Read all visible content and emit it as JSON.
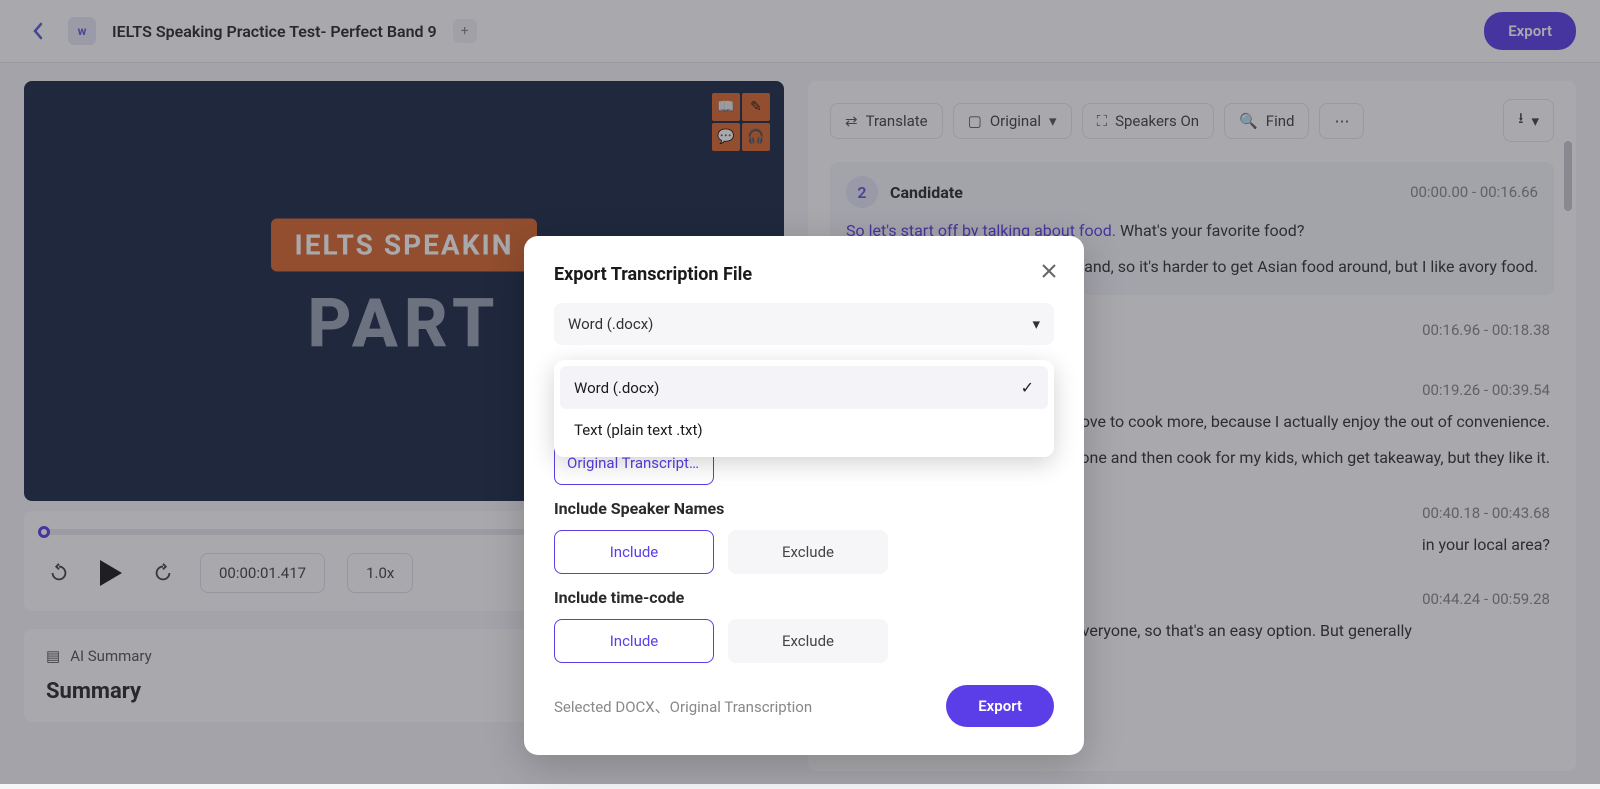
{
  "header": {
    "title": "IELTS Speaking Practice Test- Perfect Band 9",
    "export_label": "Export"
  },
  "video": {
    "badge": "IELTS SPEAKIN",
    "part": "PART",
    "time": "00:00:01.417",
    "speed": "1.0x"
  },
  "ai_summary": {
    "header": "AI Summary",
    "title": "Summary"
  },
  "toolbar": {
    "translate": "Translate",
    "original": "Original",
    "speakers": "Speakers On",
    "find": "Find"
  },
  "transcript": [
    {
      "badge": "2",
      "speaker": "Candidate",
      "time": "00:00.00 - 00:16.66",
      "highlight": "So let's start off by talking about food.",
      "rest": " What's your favorite food?",
      "body": "gland, so it's harder to get Asian food around, but I like avory food."
    },
    {
      "time": "00:16.96 - 00:18.38"
    },
    {
      "time": "00:19.26 - 00:39.54",
      "body": "ould love to cook more, because I actually enjoy the out of convenience.",
      "body2": "et my work done and then cook for my kids, which get takeaway, but they like it."
    },
    {
      "time": "00:40.18 - 00:43.68",
      "body": "in your local area?"
    },
    {
      "time": "00:44.24 - 00:59.28",
      "body": "Fish and chips. It's a favorite with everyone, so that's an easy option. But generally"
    }
  ],
  "modal": {
    "title": "Export Transcription File",
    "select_value": "Word (.docx)",
    "options": [
      {
        "label": "Word (.docx)",
        "selected": true
      },
      {
        "label": "Text (plain text .txt)",
        "selected": false
      }
    ],
    "chip_original": "Original Transcripti…",
    "section_speaker": "Include Speaker Names",
    "section_timecode": "Include time-code",
    "include": "Include",
    "exclude": "Exclude",
    "footer_text": "Selected DOCX、Original Transcription",
    "confirm": "Export"
  }
}
